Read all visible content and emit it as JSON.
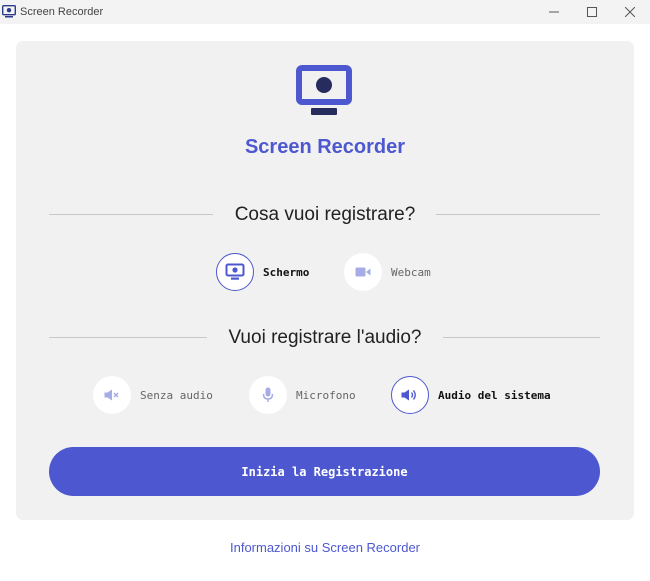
{
  "window": {
    "title": "Screen Recorder"
  },
  "app": {
    "heading": "Screen Recorder"
  },
  "source": {
    "title": "Cosa vuoi registrare?",
    "options": [
      {
        "label": "Schermo",
        "icon": "monitor-icon",
        "selected": true
      },
      {
        "label": "Webcam",
        "icon": "video-camera-icon",
        "selected": false
      }
    ]
  },
  "audio": {
    "title": "Vuoi registrare l'audio?",
    "options": [
      {
        "label": "Senza audio",
        "icon": "speaker-muted-icon",
        "selected": false
      },
      {
        "label": "Microfono",
        "icon": "microphone-icon",
        "selected": false
      },
      {
        "label": "Audio del sistema",
        "icon": "speaker-icon",
        "selected": true
      }
    ]
  },
  "actions": {
    "start_label": "Inizia la Registrazione"
  },
  "footer": {
    "about_link": "Informazioni su Screen Recorder"
  },
  "colors": {
    "accent": "#4d58d0",
    "accent_light": "#a6ade6",
    "card_bg": "#f1f1f1",
    "titlebar_bg": "#f3f3f3"
  }
}
